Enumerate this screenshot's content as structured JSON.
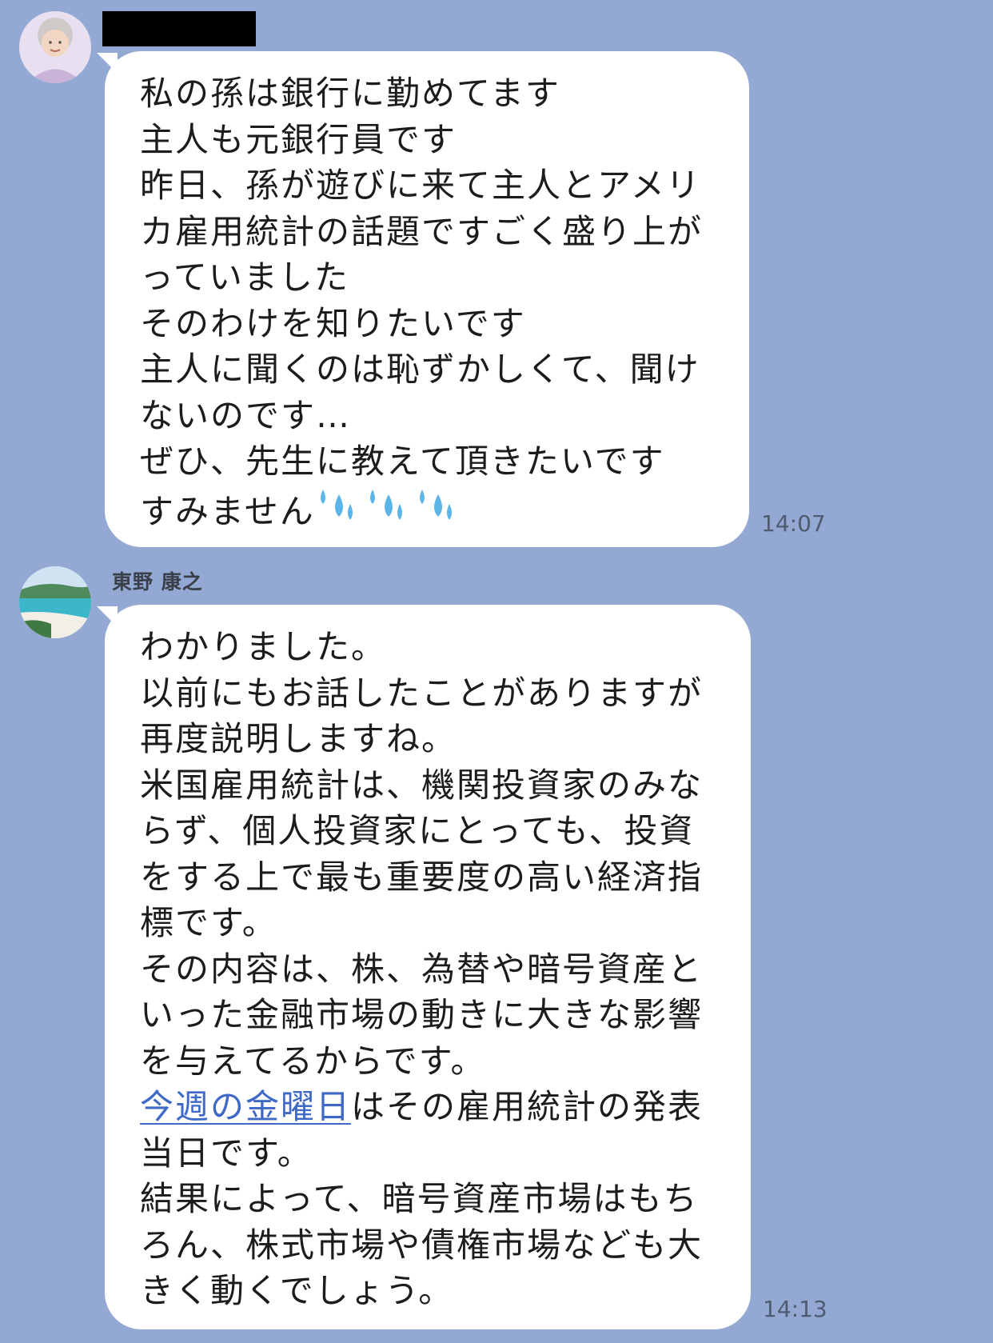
{
  "chat": {
    "messages": [
      {
        "sender": "",
        "sender_redacted": true,
        "avatar": "elderly-woman-avatar",
        "lines": [
          "私の孫は銀行に勤めてます",
          "主人も元銀行員です",
          "昨日、孫が遊びに来て主人とアメリ",
          "カ雇用統計の話題ですごく盛り上が",
          "っていました",
          "そのわけを知りたいです",
          "主人に聞くのは恥ずかしくて、聞け",
          "ないのです…",
          "ぜひ、先生に教えて頂きたいです",
          "すみません"
        ],
        "emoji": "sweat-droplets-emoji",
        "time": "14:07"
      },
      {
        "sender": "東野 康之",
        "avatar": "beach-avatar",
        "lines": [
          "わかりました。",
          "以前にもお話したことがありますが",
          "再度説明しますね。",
          "米国雇用統計は、機関投資家のみな",
          "らず、個人投資家にとっても、投資",
          "をする上で最も重要度の高い経済指",
          "標です。",
          "その内容は、株、為替や暗号資産と",
          "いった金融市場の動きに大きな影響",
          "を与えてるからです。"
        ],
        "link_text": "今週の金曜日",
        "link_line_rest": "はその雇用統計の発表",
        "lines_after": [
          "当日です。",
          "結果によって、暗号資産市場はもち",
          "ろん、株式市場や債権市場なども大",
          "きく動くでしょう。"
        ],
        "time": "14:13"
      }
    ]
  },
  "colors": {
    "background": "#93a9d3",
    "bubble": "#ffffff",
    "link": "#3f69c7",
    "drop": "#5bb5e8"
  }
}
